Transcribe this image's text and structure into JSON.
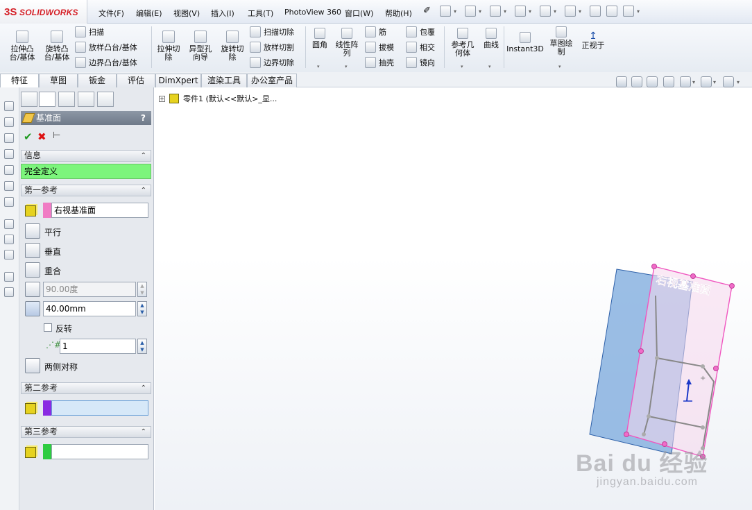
{
  "app": {
    "logo_mark": "3S",
    "logo_text": "SOLIDWORKS"
  },
  "menu": [
    "文件(F)",
    "编辑(E)",
    "视图(V)",
    "插入(I)",
    "工具(T)",
    "PhotoView 360",
    "窗口(W)",
    "帮助(H)"
  ],
  "toolbar": {
    "extrude_boss": "拉伸凸\n台/基体",
    "revolve_boss": "旋转凸\n台/基体",
    "sweep": "扫描",
    "loft": "放样凸台/基体",
    "boundary": "边界凸台/基体",
    "extrude_cut": "拉伸切\n除",
    "hole_wizard": "异型孔\n向导",
    "revolve_cut": "旋转切\n除",
    "swept_cut": "扫描切除",
    "lofted_cut": "放样切割",
    "boundary_cut": "边界切除",
    "fillet": "圆角",
    "linear_pattern": "线性阵\n列",
    "rib": "筋",
    "draft": "拔模",
    "shell": "抽壳",
    "wrap": "包覆",
    "intersect": "相交",
    "mirror": "镜向",
    "ref_geometry": "参考几\n何体",
    "curves": "曲线",
    "instant3d": "Instant3D",
    "sketch_draw": "草图绘\n制",
    "normal_to": "正视于"
  },
  "tabs": [
    "特征",
    "草图",
    "钣金",
    "评估",
    "DimXpert",
    "渲染工具",
    "办公室产品"
  ],
  "active_tab": "特征",
  "panel": {
    "title": "基准面",
    "help": "?",
    "info_header": "信息",
    "status": "完全定义",
    "ref1_header": "第一参考",
    "ref1_value": "右视基准面",
    "parallel": "平行",
    "perpendicular": "垂直",
    "coincident": "重合",
    "angle_value": "90.00度",
    "distance_value": "40.00mm",
    "flip": "反转",
    "count_value": "1",
    "mid_plane": "两侧对称",
    "ref2_header": "第二参考",
    "ref3_header": "第三参考",
    "ref1_color": "#f07cc4",
    "ref2_color": "#8a2be2",
    "ref3_color": "#2ecc40"
  },
  "tree": {
    "root_label": "零件1  (默认<<默认>_显..."
  },
  "viewport": {
    "plane_label": "右视基准面"
  },
  "watermark": {
    "main": "Bai du 经验",
    "sub": "jingyan.baidu.com"
  }
}
